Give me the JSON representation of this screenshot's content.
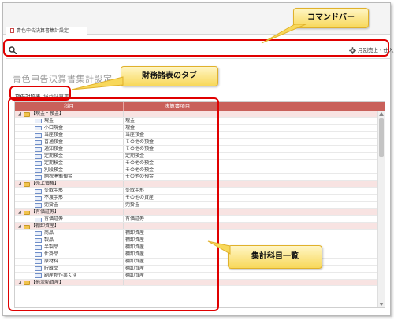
{
  "window": {
    "tab_title": "青色申告決算書集計設定"
  },
  "command_bar": {
    "search_icon": "search-icon",
    "settings_icon": "gear-icon",
    "settings_label": "月別売上・仕入"
  },
  "page": {
    "title": "青色申告決算書集計設定"
  },
  "tabs": [
    {
      "label": "貸借対照表",
      "active": true
    },
    {
      "label": "損益計算書",
      "active": false
    }
  ],
  "grid": {
    "columns": [
      "科目",
      "決算書項目"
    ],
    "rows": [
      {
        "type": "group",
        "label": "【現金・預金】",
        "mapping": ""
      },
      {
        "type": "item",
        "label": "現金",
        "mapping": "現金"
      },
      {
        "type": "item",
        "label": "小口現金",
        "mapping": "現金"
      },
      {
        "type": "item",
        "label": "当座預金",
        "mapping": "当座預金"
      },
      {
        "type": "item",
        "label": "普通預金",
        "mapping": "その他の預金"
      },
      {
        "type": "item",
        "label": "通知預金",
        "mapping": "その他の預金"
      },
      {
        "type": "item",
        "label": "定期預金",
        "mapping": "定期預金"
      },
      {
        "type": "item",
        "label": "定期積金",
        "mapping": "その他の預金"
      },
      {
        "type": "item",
        "label": "別段預金",
        "mapping": "その他の預金"
      },
      {
        "type": "item",
        "label": "納税準備預金",
        "mapping": "その他の預金"
      },
      {
        "type": "group",
        "label": "【売上債権】",
        "mapping": ""
      },
      {
        "type": "item",
        "label": "受取手形",
        "mapping": "受取手形"
      },
      {
        "type": "item",
        "label": "不渡手形",
        "mapping": "その他の資産"
      },
      {
        "type": "item",
        "label": "売掛金",
        "mapping": "売掛金"
      },
      {
        "type": "group",
        "label": "【有価証券】",
        "mapping": ""
      },
      {
        "type": "item",
        "label": "有価証券",
        "mapping": "有価証券"
      },
      {
        "type": "group",
        "label": "【棚卸資産】",
        "mapping": ""
      },
      {
        "type": "item",
        "label": "商品",
        "mapping": "棚卸資産"
      },
      {
        "type": "item",
        "label": "製品",
        "mapping": "棚卸資産"
      },
      {
        "type": "item",
        "label": "半製品",
        "mapping": "棚卸資産"
      },
      {
        "type": "item",
        "label": "仕掛品",
        "mapping": "棚卸資産"
      },
      {
        "type": "item",
        "label": "原材料",
        "mapping": "棚卸資産"
      },
      {
        "type": "item",
        "label": "貯蔵品",
        "mapping": "棚卸資産"
      },
      {
        "type": "item",
        "label": "副産物作業くず",
        "mapping": "棚卸資産"
      },
      {
        "type": "group",
        "label": "【他流動資産】",
        "mapping": ""
      }
    ]
  },
  "annotations": {
    "command_bar": "コマンドバー",
    "financial_tabs": "財務諸表のタブ",
    "account_list": "集計科目一覧"
  },
  "colors": {
    "header_bg": "#c9605a",
    "group_row_bg": "#f8e3e2",
    "highlight": "#e00000",
    "callout": "#f8d85a"
  }
}
